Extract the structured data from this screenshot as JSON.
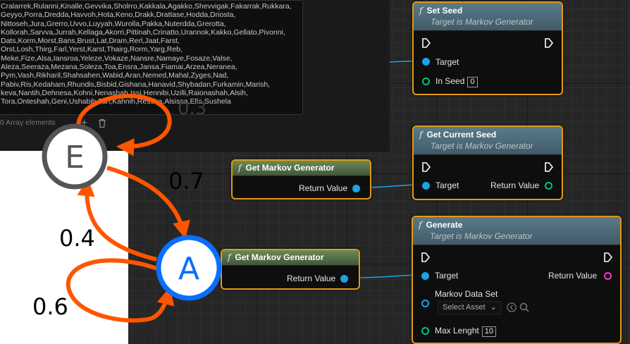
{
  "details_panel": {
    "array_text": "Cralarrek,Rulanni,Kinalle,Gevvika,Sholrro,Kakkala,Agakko,Shevvigak,Fakarrak,Rukkara,\nGeyyo,Porra,Dredda,Havvoh,Hota,Keno,Drakk,Drattase,Hodda,Driosta,\nNittoseh,Jura,Grerro,Uvvo,Luyyah,Wurolla,Pakka,Nuterdda,Grerotta,\nKollorah,Sarvva,Jurrah,Kellaga,Akorri,Pittinah,Crinatto,Urannok,Kakko,Gellato,Pivonni,\nDats,Korm,Morst,Bans,Brust,Lat,Dram,Rerl,Jaat,Farst,\nOrst,Losh,Thirg,Farl,Yerst,Karst,Thairg,Rorm,Yarg,Reb,\nMeke,Fize,Alsa,Iansroa,Yeleze,Vokaze,Nansre,Namaye,Fosaze,Valse,\nAleza,Seeraza,Mezana,Soleza,Toa,Ensra,Jansa,Fiamai,Arzea,Neranea,\nPym,Vash,Rikharil,Shahsahen,Wabid,Aran,Nemed,Mahal,Zyges,Nad,\nPabiv,Ris,Kedaham,Rhundis,Bisbid,Gishana,Hanavid,Shybadan,Furkamin,Marish,\nkeva,Nantih,Dehnesa,Kohni,Nenashah,Issi,Hennibi,Uzilli,Raionashah,Alsih,\nTora,Onteshah,Geni,Ushabih,Tari,Kahnih,Ressira,Alsissa,Ella,Sushela",
    "array_count": "0 Array elements",
    "add_icon": "plus-icon",
    "delete_icon": "trash-icon"
  },
  "nodes": {
    "set_seed": {
      "title": "Set Seed",
      "subtitle": "Target is Markov Generator",
      "target_label": "Target",
      "in_seed_label": "In Seed",
      "in_seed_value": "0"
    },
    "get_current_seed": {
      "title": "Get Current Seed",
      "subtitle": "Target is Markov Generator",
      "target_label": "Target",
      "return_label": "Return Value"
    },
    "get_markov_1": {
      "title": "Get Markov Generator",
      "return_label": "Return Value"
    },
    "get_markov_2": {
      "title": "Get Markov Generator",
      "return_label": "Return Value"
    },
    "generate": {
      "title": "Generate",
      "subtitle": "Target is Markov Generator",
      "target_label": "Target",
      "return_label": "Return Value",
      "data_set_label": "Markov Data Set",
      "select_asset": "Select Asset",
      "max_length_label": "Max Lenght",
      "max_length_value": "10"
    }
  },
  "markov_chain": {
    "states": [
      "E",
      "A"
    ],
    "probabilities": {
      "e_self": "0.3",
      "e_to_a": "0.7",
      "a_to_e": "0.4",
      "a_self": "0.6"
    },
    "colors": {
      "arrow": "#ff5500",
      "state_e": "#555555",
      "state_a": "#0a6eff"
    }
  },
  "colors": {
    "node_border": "#e39a12",
    "wire_blue": "#1aa3e8",
    "pin_pink": "#ff2fd0",
    "pin_green": "#00c47a"
  }
}
